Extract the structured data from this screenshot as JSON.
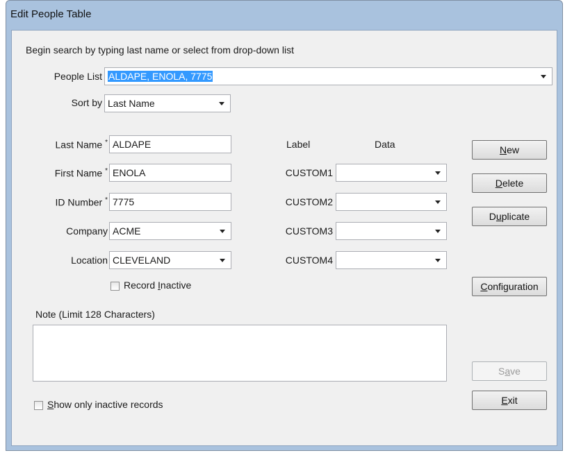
{
  "window": {
    "title": "Edit People Table"
  },
  "instructions": "Begin search by typing last name or select from drop-down list",
  "people_list": {
    "label": "People List",
    "value": "ALDAPE, ENOLA, 7775"
  },
  "sort_by": {
    "label": "Sort by",
    "value": "Last Name"
  },
  "fields": {
    "last_name": {
      "label": "Last Name",
      "value": "ALDAPE"
    },
    "first_name": {
      "label": "First Name",
      "value": "ENOLA"
    },
    "id_number": {
      "label": "ID Number",
      "value": "7775"
    },
    "company": {
      "label": "Company",
      "value": "ACME"
    },
    "location": {
      "label": "Location",
      "value": "CLEVELAND"
    },
    "required_mark": "*"
  },
  "record_inactive": {
    "pre": "Record ",
    "accel": "I",
    "post": "nactive",
    "checked": false
  },
  "custom": {
    "label_header": "Label",
    "data_header": "Data",
    "items": [
      {
        "label": "CUSTOM1",
        "value": ""
      },
      {
        "label": "CUSTOM2",
        "value": ""
      },
      {
        "label": "CUSTOM3",
        "value": ""
      },
      {
        "label": "CUSTOM4",
        "value": ""
      }
    ]
  },
  "note": {
    "label": "Note (Limit 128 Characters)",
    "value": ""
  },
  "show_inactive": {
    "pre": "",
    "accel": "S",
    "post": "how only inactive records",
    "checked": false
  },
  "buttons": {
    "new": {
      "pre": "",
      "accel": "N",
      "post": "ew"
    },
    "delete": {
      "pre": "",
      "accel": "D",
      "post": "elete"
    },
    "duplicate": {
      "pre": "D",
      "accel": "u",
      "post": "plicate"
    },
    "configuration": {
      "pre": "",
      "accel": "C",
      "post": "onfiguration"
    },
    "save": {
      "pre": "S",
      "accel": "a",
      "post": "ve",
      "enabled": false
    },
    "exit": {
      "pre": "",
      "accel": "E",
      "post": "xit"
    }
  },
  "colors": {
    "selection": "#3399ff",
    "frame": "#a9c2de",
    "client": "#f0f0f0"
  }
}
